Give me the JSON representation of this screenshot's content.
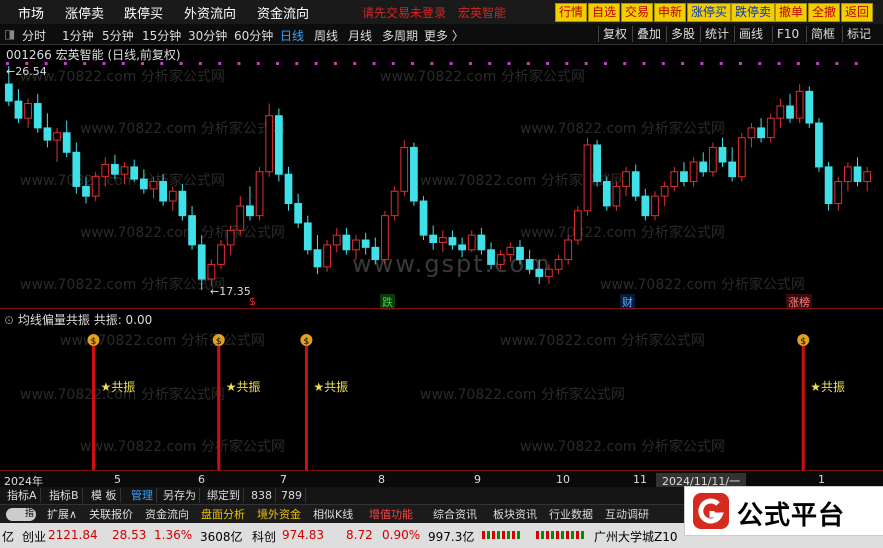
{
  "topmenu": {
    "items": [
      "市场",
      "涨停卖",
      "跌停买",
      "外资流向",
      "资金流向"
    ],
    "login_hint": "请先交易未登录",
    "stock_hint": "宏英智能",
    "buttons": [
      "行情",
      "自选",
      "交易",
      "申新",
      "涨停买",
      "跌停卖",
      "撤单",
      "全撤",
      "返回"
    ]
  },
  "periods": {
    "items": [
      "分时",
      "1分钟",
      "5分钟",
      "15分钟",
      "30分钟",
      "60分钟",
      "日线",
      "周线",
      "月线",
      "多周期",
      "更多 〉"
    ],
    "active": "日线",
    "right_buttons": [
      "复权",
      "叠加",
      "多股",
      "统计",
      "画线",
      "F10",
      "简框",
      "标记"
    ]
  },
  "stock": {
    "code_name": "001266 宏英智能 (日线,前复权)",
    "high_label": "26.54",
    "low_label": "17.35"
  },
  "event_labels": [
    "$",
    "跌",
    "财",
    "涨榜"
  ],
  "indicator": {
    "title": "均线偏量共振 共振: 0.00",
    "signal_label": "★共振",
    "signal_icon": "money-bag-icon"
  },
  "watermarks": {
    "site": "www.70822.com 分析家公式网",
    "gspt": "www.gspt.com"
  },
  "timeaxis": {
    "labels": [
      "2024年",
      "5",
      "6",
      "7",
      "8",
      "9",
      "10",
      "11",
      "2024/11/11/一",
      "1"
    ]
  },
  "tabs": {
    "toggle_label": "指",
    "items": [
      "指标A",
      "指标B",
      "模 板",
      "管理",
      "另存为",
      "绑定到",
      "838",
      "789"
    ],
    "active": "管理"
  },
  "functions": {
    "items": [
      "扩展∧",
      "关联报价",
      "资金流向",
      "盘面分析",
      "境外资金",
      "相似K线",
      "增值功能",
      "综合资讯",
      "板块资讯",
      "行业数据",
      "互动调研"
    ]
  },
  "status": {
    "prefix": "亿",
    "board1_name": "创业",
    "board1_value": "2121.84",
    "board1_change": "28.53",
    "board1_pct": "1.36%",
    "board1_amount": "3608亿",
    "board2_name": "科创",
    "board2_value": "974.83",
    "board2_change": "8.72",
    "board2_pct": "0.90%",
    "board2_amount": "997.3亿",
    "ticker_text": "广州大学城Z10"
  },
  "logo": {
    "text": "公式平台"
  },
  "colors": {
    "up": "#e03030",
    "down": "#40e0e8",
    "signal_line": "#d01010",
    "signal_text": "#f0e050",
    "accent_yellow": "#f2d000",
    "active_blue": "#3aa0ff"
  },
  "chart_data": {
    "type": "candlestick",
    "ylim": [
      17.35,
      26.54
    ],
    "candles": [
      {
        "o": 25.8,
        "h": 26.54,
        "l": 24.9,
        "c": 25.1
      },
      {
        "o": 25.1,
        "h": 25.6,
        "l": 24.2,
        "c": 24.4
      },
      {
        "o": 24.4,
        "h": 25.2,
        "l": 24.0,
        "c": 25.0
      },
      {
        "o": 25.0,
        "h": 25.4,
        "l": 23.8,
        "c": 24.0
      },
      {
        "o": 24.0,
        "h": 24.6,
        "l": 23.2,
        "c": 23.5
      },
      {
        "o": 23.5,
        "h": 24.0,
        "l": 22.6,
        "c": 23.8
      },
      {
        "o": 23.8,
        "h": 24.3,
        "l": 22.8,
        "c": 23.0
      },
      {
        "o": 23.0,
        "h": 23.4,
        "l": 21.3,
        "c": 21.6
      },
      {
        "o": 21.6,
        "h": 22.0,
        "l": 20.9,
        "c": 21.2
      },
      {
        "o": 21.2,
        "h": 22.2,
        "l": 21.0,
        "c": 22.0
      },
      {
        "o": 22.0,
        "h": 22.8,
        "l": 21.6,
        "c": 22.5
      },
      {
        "o": 22.5,
        "h": 22.9,
        "l": 21.9,
        "c": 22.1
      },
      {
        "o": 22.1,
        "h": 22.6,
        "l": 21.7,
        "c": 22.4
      },
      {
        "o": 22.4,
        "h": 22.7,
        "l": 21.8,
        "c": 21.9
      },
      {
        "o": 21.9,
        "h": 22.3,
        "l": 21.3,
        "c": 21.5
      },
      {
        "o": 21.5,
        "h": 22.0,
        "l": 21.1,
        "c": 21.8
      },
      {
        "o": 21.8,
        "h": 22.1,
        "l": 20.8,
        "c": 21.0
      },
      {
        "o": 21.0,
        "h": 21.6,
        "l": 20.6,
        "c": 21.4
      },
      {
        "o": 21.4,
        "h": 21.7,
        "l": 20.2,
        "c": 20.4
      },
      {
        "o": 20.4,
        "h": 20.8,
        "l": 19.0,
        "c": 19.2
      },
      {
        "o": 19.2,
        "h": 19.6,
        "l": 17.35,
        "c": 17.8
      },
      {
        "o": 17.8,
        "h": 18.6,
        "l": 17.5,
        "c": 18.4
      },
      {
        "o": 18.4,
        "h": 19.4,
        "l": 18.2,
        "c": 19.2
      },
      {
        "o": 19.2,
        "h": 20.0,
        "l": 18.8,
        "c": 19.8
      },
      {
        "o": 19.8,
        "h": 21.2,
        "l": 19.6,
        "c": 20.8
      },
      {
        "o": 20.8,
        "h": 21.6,
        "l": 20.2,
        "c": 20.4
      },
      {
        "o": 20.4,
        "h": 22.4,
        "l": 20.2,
        "c": 22.2
      },
      {
        "o": 22.2,
        "h": 25.0,
        "l": 22.0,
        "c": 24.5
      },
      {
        "o": 24.5,
        "h": 24.8,
        "l": 21.8,
        "c": 22.1
      },
      {
        "o": 22.1,
        "h": 22.4,
        "l": 20.6,
        "c": 20.9
      },
      {
        "o": 20.9,
        "h": 21.3,
        "l": 19.9,
        "c": 20.1
      },
      {
        "o": 20.1,
        "h": 20.4,
        "l": 18.8,
        "c": 19.0
      },
      {
        "o": 19.0,
        "h": 19.6,
        "l": 18.0,
        "c": 18.3
      },
      {
        "o": 18.3,
        "h": 19.4,
        "l": 18.1,
        "c": 19.2
      },
      {
        "o": 19.2,
        "h": 19.9,
        "l": 18.9,
        "c": 19.6
      },
      {
        "o": 19.6,
        "h": 19.9,
        "l": 18.8,
        "c": 19.0
      },
      {
        "o": 19.0,
        "h": 19.6,
        "l": 18.6,
        "c": 19.4
      },
      {
        "o": 19.4,
        "h": 19.7,
        "l": 18.8,
        "c": 19.1
      },
      {
        "o": 19.1,
        "h": 19.5,
        "l": 18.4,
        "c": 18.6
      },
      {
        "o": 18.6,
        "h": 20.6,
        "l": 18.4,
        "c": 20.4
      },
      {
        "o": 20.4,
        "h": 21.6,
        "l": 20.2,
        "c": 21.4
      },
      {
        "o": 21.4,
        "h": 23.5,
        "l": 21.2,
        "c": 23.2
      },
      {
        "o": 23.2,
        "h": 23.4,
        "l": 20.8,
        "c": 21.0
      },
      {
        "o": 21.0,
        "h": 21.2,
        "l": 19.4,
        "c": 19.6
      },
      {
        "o": 19.6,
        "h": 20.0,
        "l": 19.0,
        "c": 19.3
      },
      {
        "o": 19.3,
        "h": 19.8,
        "l": 18.9,
        "c": 19.5
      },
      {
        "o": 19.5,
        "h": 19.8,
        "l": 19.0,
        "c": 19.2
      },
      {
        "o": 19.2,
        "h": 19.5,
        "l": 18.7,
        "c": 19.0
      },
      {
        "o": 19.0,
        "h": 19.8,
        "l": 18.9,
        "c": 19.6
      },
      {
        "o": 19.6,
        "h": 19.9,
        "l": 18.8,
        "c": 19.0
      },
      {
        "o": 19.0,
        "h": 19.3,
        "l": 18.2,
        "c": 18.4
      },
      {
        "o": 18.4,
        "h": 19.0,
        "l": 18.2,
        "c": 18.8
      },
      {
        "o": 18.8,
        "h": 19.3,
        "l": 18.5,
        "c": 19.1
      },
      {
        "o": 19.1,
        "h": 19.4,
        "l": 18.4,
        "c": 18.6
      },
      {
        "o": 18.6,
        "h": 19.0,
        "l": 18.0,
        "c": 18.2
      },
      {
        "o": 18.2,
        "h": 18.6,
        "l": 17.6,
        "c": 17.9
      },
      {
        "o": 17.9,
        "h": 18.4,
        "l": 17.6,
        "c": 18.2
      },
      {
        "o": 18.2,
        "h": 18.8,
        "l": 18.0,
        "c": 18.6
      },
      {
        "o": 18.6,
        "h": 19.6,
        "l": 18.4,
        "c": 19.4
      },
      {
        "o": 19.4,
        "h": 20.8,
        "l": 19.2,
        "c": 20.6
      },
      {
        "o": 20.6,
        "h": 23.6,
        "l": 20.4,
        "c": 23.3
      },
      {
        "o": 23.3,
        "h": 23.5,
        "l": 21.6,
        "c": 21.8
      },
      {
        "o": 21.8,
        "h": 22.0,
        "l": 20.6,
        "c": 20.8
      },
      {
        "o": 20.8,
        "h": 21.8,
        "l": 20.6,
        "c": 21.6
      },
      {
        "o": 21.6,
        "h": 22.4,
        "l": 21.2,
        "c": 22.2
      },
      {
        "o": 22.2,
        "h": 22.5,
        "l": 21.0,
        "c": 21.2
      },
      {
        "o": 21.2,
        "h": 21.5,
        "l": 20.2,
        "c": 20.4
      },
      {
        "o": 20.4,
        "h": 21.4,
        "l": 20.2,
        "c": 21.2
      },
      {
        "o": 21.2,
        "h": 21.8,
        "l": 20.8,
        "c": 21.6
      },
      {
        "o": 21.6,
        "h": 22.4,
        "l": 21.4,
        "c": 22.2
      },
      {
        "o": 22.2,
        "h": 22.6,
        "l": 21.6,
        "c": 21.8
      },
      {
        "o": 21.8,
        "h": 22.8,
        "l": 21.6,
        "c": 22.6
      },
      {
        "o": 22.6,
        "h": 23.0,
        "l": 22.0,
        "c": 22.2
      },
      {
        "o": 22.2,
        "h": 23.4,
        "l": 22.0,
        "c": 23.2
      },
      {
        "o": 23.2,
        "h": 23.6,
        "l": 22.4,
        "c": 22.6
      },
      {
        "o": 22.6,
        "h": 23.2,
        "l": 21.8,
        "c": 22.0
      },
      {
        "o": 22.0,
        "h": 23.8,
        "l": 21.8,
        "c": 23.6
      },
      {
        "o": 23.6,
        "h": 24.2,
        "l": 23.2,
        "c": 24.0
      },
      {
        "o": 24.0,
        "h": 24.4,
        "l": 23.4,
        "c": 23.6
      },
      {
        "o": 23.6,
        "h": 24.6,
        "l": 23.4,
        "c": 24.4
      },
      {
        "o": 24.4,
        "h": 25.2,
        "l": 24.0,
        "c": 24.9
      },
      {
        "o": 24.9,
        "h": 25.4,
        "l": 24.2,
        "c": 24.4
      },
      {
        "o": 24.4,
        "h": 25.8,
        "l": 24.2,
        "c": 25.5
      },
      {
        "o": 25.5,
        "h": 25.7,
        "l": 24.0,
        "c": 24.2
      },
      {
        "o": 24.2,
        "h": 24.4,
        "l": 22.2,
        "c": 22.4
      },
      {
        "o": 22.4,
        "h": 22.6,
        "l": 20.6,
        "c": 20.9
      },
      {
        "o": 20.9,
        "h": 22.0,
        "l": 20.6,
        "c": 21.8
      },
      {
        "o": 21.8,
        "h": 22.6,
        "l": 21.4,
        "c": 22.4
      },
      {
        "o": 22.4,
        "h": 22.8,
        "l": 21.6,
        "c": 21.8
      },
      {
        "o": 21.8,
        "h": 22.4,
        "l": 21.4,
        "c": 22.2
      }
    ],
    "signals": [
      0.1,
      0.25,
      0.355,
      0.95
    ]
  }
}
